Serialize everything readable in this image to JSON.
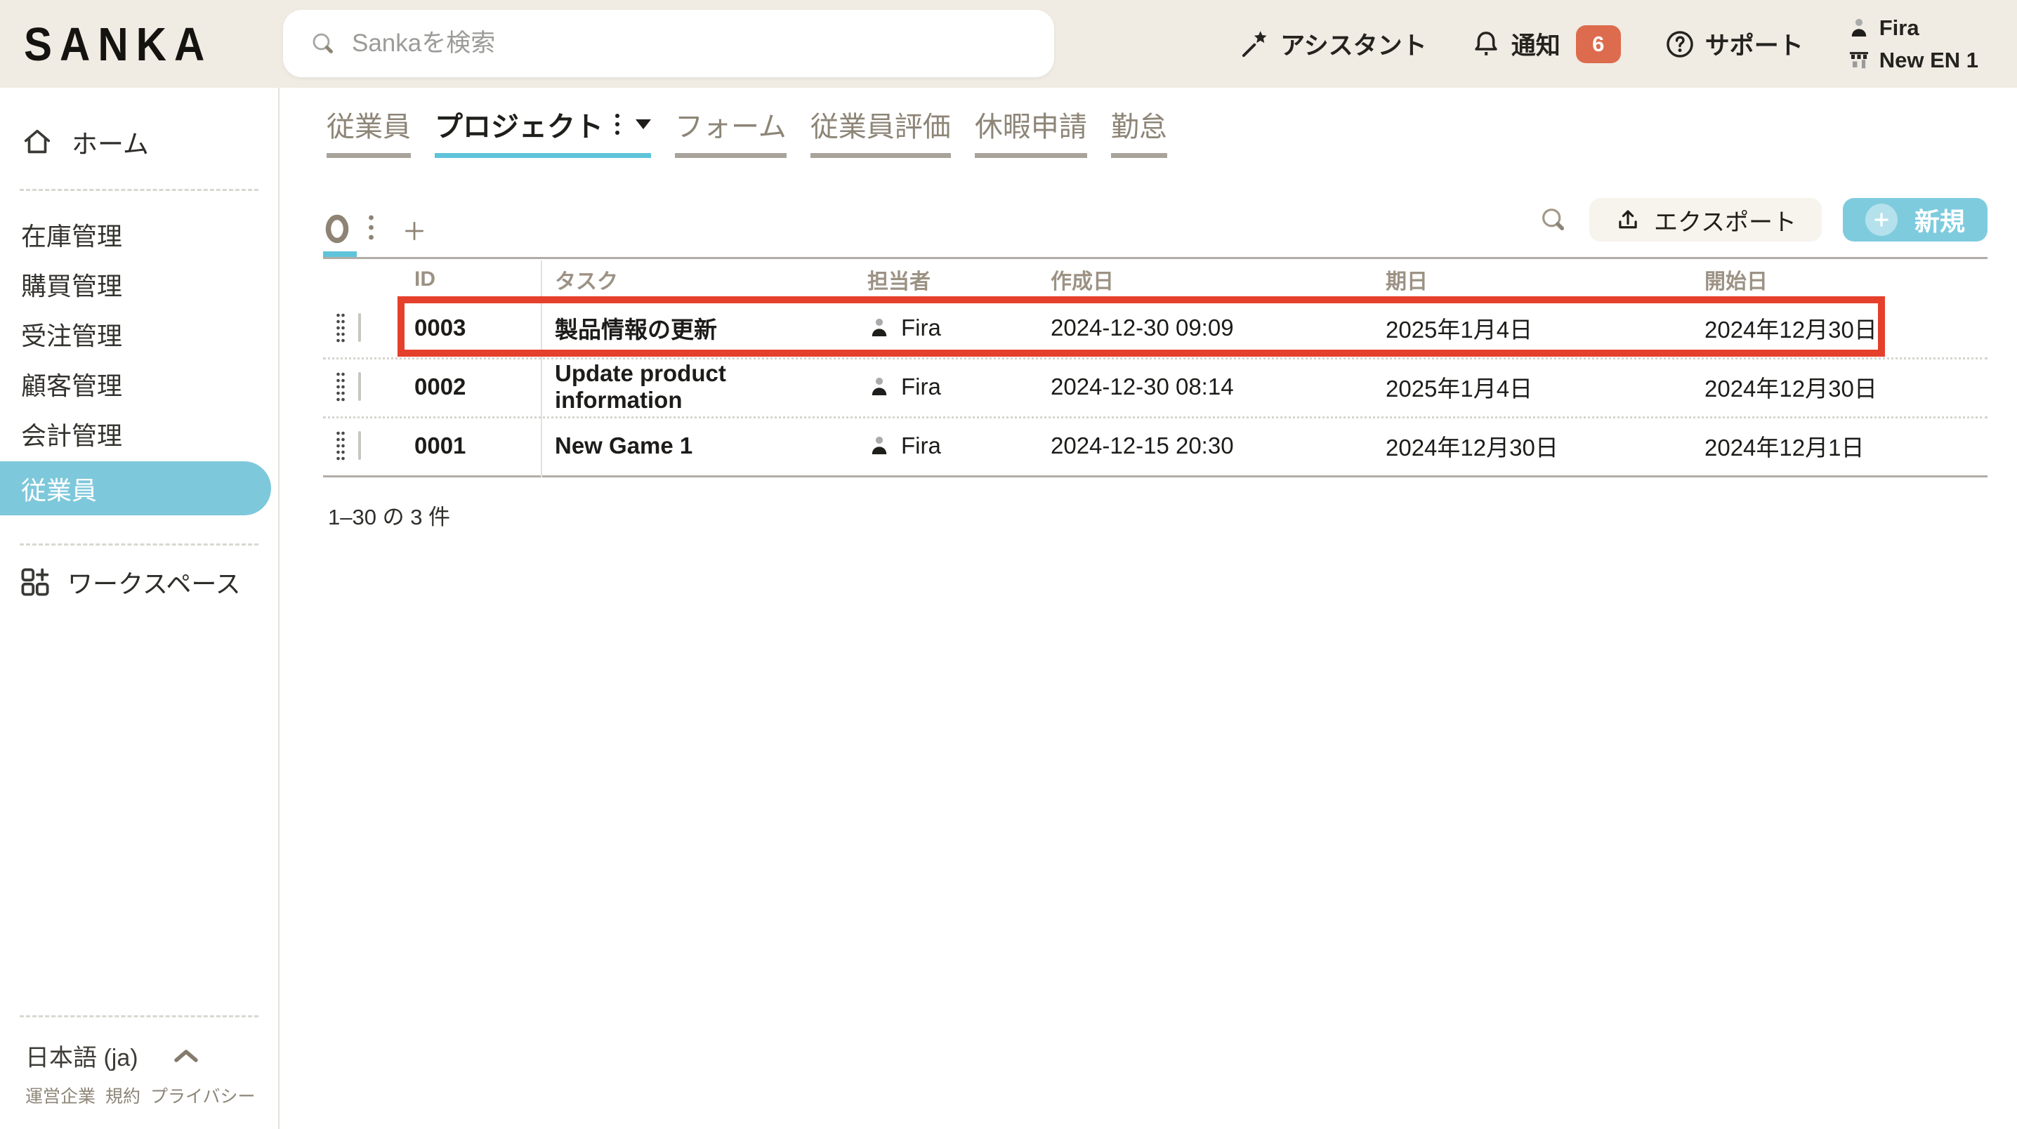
{
  "header": {
    "logo": "SANKA",
    "search_placeholder": "Sankaを検索",
    "assistant_label": "アシスタント",
    "notifications_label": "通知",
    "notifications_count": "6",
    "support_label": "サポート",
    "user_name": "Fira",
    "workspace_name": "New EN 1"
  },
  "sidebar": {
    "home_label": "ホーム",
    "items": [
      {
        "label": "在庫管理"
      },
      {
        "label": "購買管理"
      },
      {
        "label": "受注管理"
      },
      {
        "label": "顧客管理"
      },
      {
        "label": "会計管理"
      },
      {
        "label": "従業員",
        "active": true
      }
    ],
    "workspace_label": "ワークスペース",
    "language_label": "日本語 (ja)",
    "footer_links": [
      {
        "label": "運営企業"
      },
      {
        "label": "規約"
      },
      {
        "label": "プライバシー"
      }
    ]
  },
  "tabs": [
    {
      "label": "従業員"
    },
    {
      "label": "プロジェクト",
      "active": true
    },
    {
      "label": "フォーム"
    },
    {
      "label": "従業員評価"
    },
    {
      "label": "休暇申請"
    },
    {
      "label": "勤怠"
    }
  ],
  "toolbar": {
    "export_label": "エクスポート",
    "new_label": "新規"
  },
  "table": {
    "columns": [
      "ID",
      "タスク",
      "担当者",
      "作成日",
      "期日",
      "開始日"
    ],
    "rows": [
      {
        "id": "0003",
        "task": "製品情報の更新",
        "assignee": "Fira",
        "created": "2024-12-30 09:09",
        "due": "2025年1月4日",
        "start": "2024年12月30日",
        "highlighted": true
      },
      {
        "id": "0002",
        "task": "Update product information",
        "assignee": "Fira",
        "created": "2024-12-30 08:14",
        "due": "2025年1月4日",
        "start": "2024年12月30日",
        "highlighted": false
      },
      {
        "id": "0001",
        "task": "New Game 1",
        "assignee": "Fira",
        "created": "2024-12-15 20:30",
        "due": "2024年12月30日",
        "start": "2024年12月1日",
        "highlighted": false
      }
    ],
    "summary": "1–30 の 3 件"
  },
  "icons": {
    "search-icon": "⌕",
    "assistant-wand-icon": "✦",
    "notification-bell-icon": "🔔",
    "support-question-icon": "?",
    "user-person-icon": "👤",
    "workspace-store-icon": "🏬",
    "home-icon": "⌂",
    "workspace-grid-plus-icon": "⊞",
    "kebab-icon": "⋮",
    "caret-down-icon": "▼",
    "view-circle-icon": "○",
    "add-view-plus-icon": "+",
    "export-upload-icon": "↥",
    "new-plus-icon": "+",
    "drag-handle-icon": "⠿",
    "chevron-up-icon": "⌃"
  },
  "colors": {
    "header_bg": "#F0EBE3",
    "accent_teal": "#7ECBDE",
    "tab_underline_active": "#5FC4DA",
    "sidebar_active_bg": "#7EC8DB",
    "notification_badge": "#DD6B4D",
    "highlight_border": "#E5402B"
  }
}
